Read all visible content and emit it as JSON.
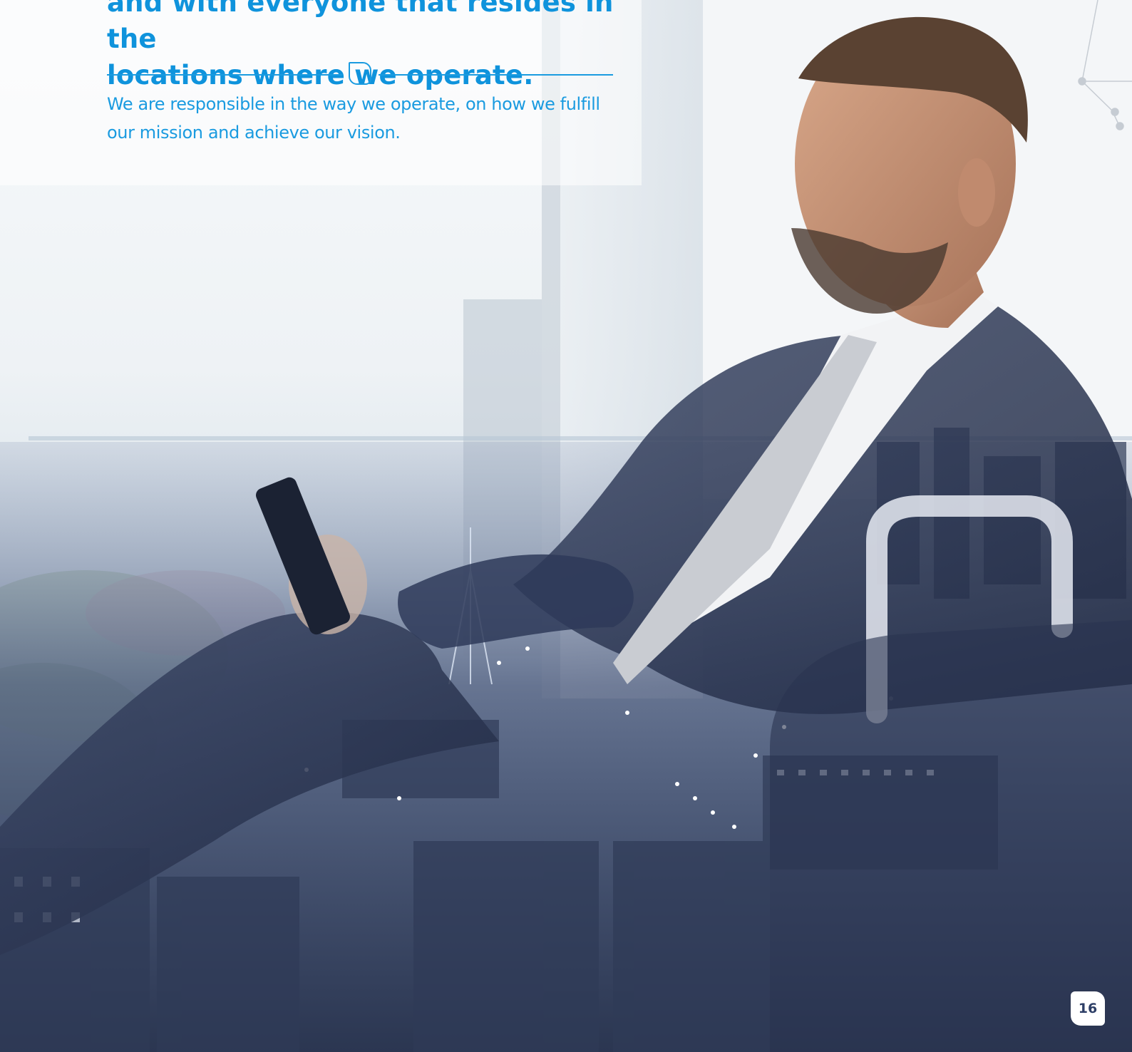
{
  "heading": {
    "line1": "and with everyone that resides in the",
    "line2": "locations where we operate."
  },
  "body_text": "We are responsible in the way we operate, on how we fulfill our mission and achieve our vision.",
  "page_number": "16",
  "colors": {
    "accent": "#1a9be0",
    "heading": "#0f93dc",
    "page_number_text": "#2d3e66"
  },
  "image": {
    "description_icon": "businessman-city-double-exposure-photo"
  }
}
